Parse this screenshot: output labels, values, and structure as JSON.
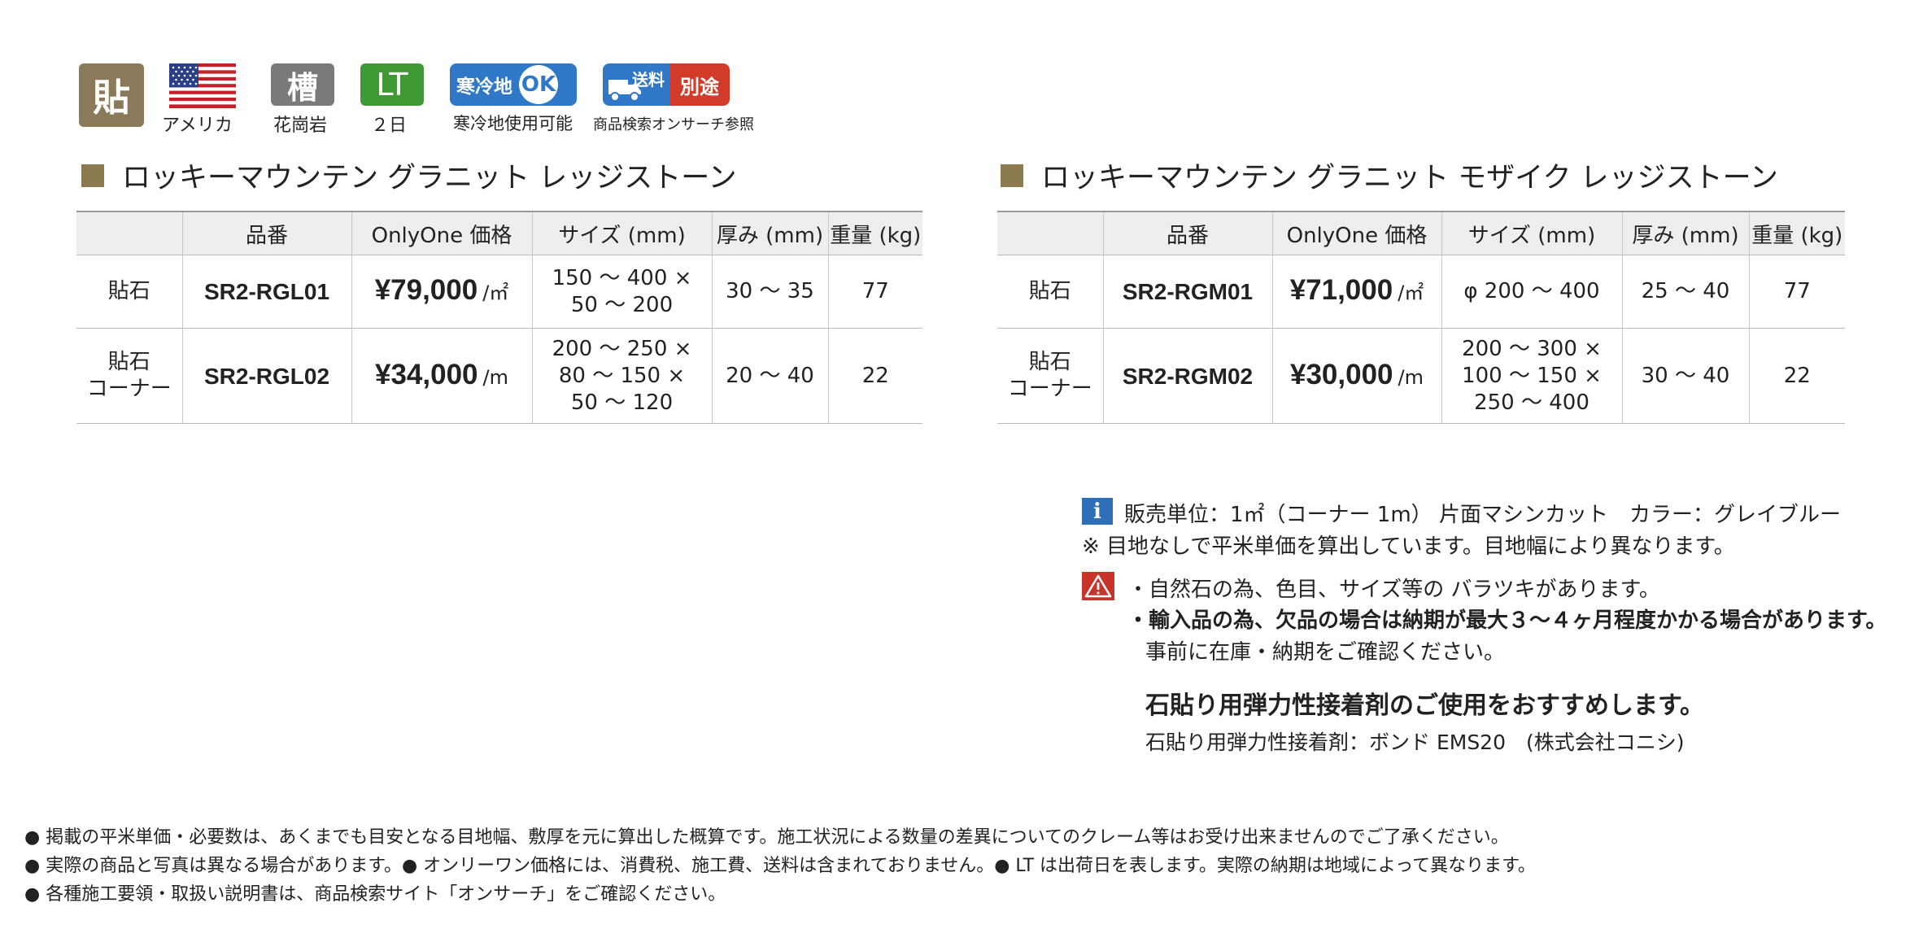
{
  "icons": [
    {
      "name": "harite",
      "symbol": "貼",
      "caption": ""
    },
    {
      "name": "flag",
      "symbol": "",
      "caption": "アメリカ"
    },
    {
      "name": "granite",
      "symbol": "槽",
      "caption": "花崗岩"
    },
    {
      "name": "lead-time",
      "symbol": "LT",
      "caption": "２日"
    },
    {
      "name": "cold-region",
      "symbol": "寒冷地",
      "ok": "OK",
      "caption": "寒冷地使用可能"
    },
    {
      "name": "shipping",
      "symbol": "送料",
      "extra": "別途",
      "caption": "商品検索オンサーチ参照"
    }
  ],
  "tables": [
    {
      "title": "ロッキーマウンテン グラニット レッジストーン",
      "headers": [
        "",
        "品番",
        "OnlyOne 価格",
        "サイズ (mm)",
        "厚み (mm)",
        "重量 (kg)"
      ],
      "rows": [
        {
          "type": [
            "貼石"
          ],
          "code": "SR2-RGL01",
          "price": "¥79,000",
          "unit": "/㎡",
          "size": [
            "150 ～ 400 ×",
            "50 ～ 200"
          ],
          "thickness": "30 ～ 35",
          "weight": "77"
        },
        {
          "type": [
            "貼石",
            "コーナー"
          ],
          "code": "SR2-RGL02",
          "price": "¥34,000",
          "unit": "/m",
          "size": [
            "200 ～ 250 ×",
            "80 ～ 150 ×",
            "50 ～ 120"
          ],
          "thickness": "20 ～ 40",
          "weight": "22"
        }
      ]
    },
    {
      "title": "ロッキーマウンテン グラニット モザイク レッジストーン",
      "headers": [
        "",
        "品番",
        "OnlyOne 価格",
        "サイズ (mm)",
        "厚み (mm)",
        "重量 (kg)"
      ],
      "rows": [
        {
          "type": [
            "貼石"
          ],
          "code": "SR2-RGM01",
          "price": "¥71,000",
          "unit": "/㎡",
          "size": [
            "φ 200 ～ 400"
          ],
          "thickness": "25 ～ 40",
          "weight": "77"
        },
        {
          "type": [
            "貼石",
            "コーナー"
          ],
          "code": "SR2-RGM02",
          "price": "¥30,000",
          "unit": "/m",
          "size": [
            "200 ～ 300 ×",
            "100 ～ 150 ×",
            "250 ～ 400"
          ],
          "thickness": "30 ～ 40",
          "weight": "22"
        }
      ]
    }
  ],
  "info": {
    "line1": "販売単位：1㎡（コーナー 1m） 片面マシンカット　カラー：グレイブルー",
    "line2": "※ 目地なしで平米単価を算出しています。目地幅により異なります。"
  },
  "warning": {
    "line1": "・自然石の為、色目、サイズ等の バラツキがあります。",
    "line2": "・輸入品の為、欠品の場合は納期が最大３～４ヶ月程度かかる場合があります。",
    "line3": "事前に在庫・納期をご確認ください。",
    "recommend": "石貼り用弾力性接着剤のご使用をおすすめします。",
    "adhesive": "石貼り用弾力性接着剤：ボンド EMS20　(株式会社コニシ)"
  },
  "footer": [
    "● 掲載の平米単価・必要数は、あくまでも目安となる目地幅、敷厚を元に算出した概算です。施工状況による数量の差異についてのクレーム等はお受け出来ませんのでご了承ください。",
    "● 実際の商品と写真は異なる場合があります。● オンリーワン価格には、消費税、施工費、送料は含まれておりません。● LT は出荷日を表します。実際の納期は地域によって異なります。",
    "● 各種施工要領・取扱い説明書は、商品検索サイト「オンサーチ」をご確認ください。"
  ],
  "colors": {
    "heading_square": "#8a7a4e",
    "kanji_tile": "#8a7a5a",
    "granite_tile": "#7a7a7a",
    "lt_tile": "#3f9a35",
    "blue": "#2f78c7",
    "red": "#d23a2a",
    "warn": "#c8332a"
  }
}
